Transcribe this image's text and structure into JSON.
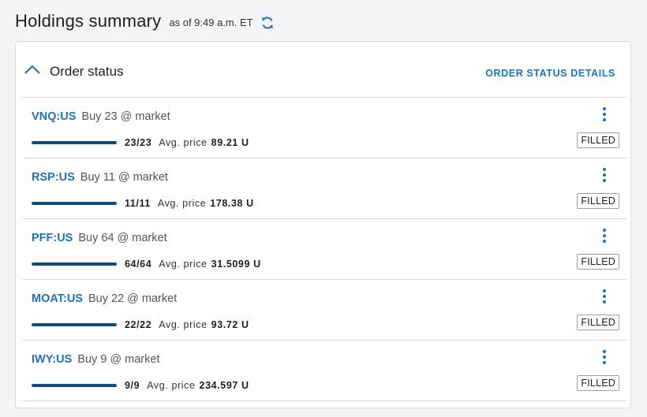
{
  "header": {
    "title": "Holdings summary",
    "timestamp": "as of 9:49 a.m. ET"
  },
  "section": {
    "title": "Order status",
    "details_link": "ORDER STATUS DETAILS"
  },
  "colors": {
    "accent": "#1a73b8",
    "progress": "#0f4c7b"
  },
  "icons": {
    "refresh": "refresh-icon",
    "collapse": "chevron-up-icon",
    "menu": "kebab-menu-icon"
  },
  "orders": [
    {
      "symbol": "VNQ:US",
      "description": "Buy 23 @ market",
      "quantity": "23/23",
      "avg_label": "Avg. price",
      "avg_price": "89.21 U",
      "status": "FILLED",
      "progress": 1.0
    },
    {
      "symbol": "RSP:US",
      "description": "Buy 11 @ market",
      "quantity": "11/11",
      "avg_label": "Avg. price",
      "avg_price": "178.38 U",
      "status": "FILLED",
      "progress": 1.0
    },
    {
      "symbol": "PFF:US",
      "description": "Buy 64 @ market",
      "quantity": "64/64",
      "avg_label": "Avg. price",
      "avg_price": "31.5099 U",
      "status": "FILLED",
      "progress": 1.0
    },
    {
      "symbol": "MOAT:US",
      "description": "Buy 22 @ market",
      "quantity": "22/22",
      "avg_label": "Avg. price",
      "avg_price": "93.72 U",
      "status": "FILLED",
      "progress": 1.0
    },
    {
      "symbol": "IWY:US",
      "description": "Buy 9 @ market",
      "quantity": "9/9",
      "avg_label": "Avg. price",
      "avg_price": "234.597 U",
      "status": "FILLED",
      "progress": 1.0
    }
  ]
}
